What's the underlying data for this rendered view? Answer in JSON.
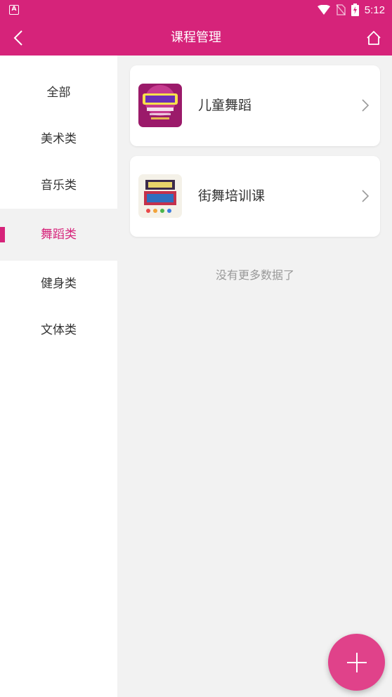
{
  "status_bar": {
    "app_icon_letter": "A",
    "time": "5:12",
    "icons": [
      "wifi-icon",
      "no-sim-icon",
      "battery-charging-icon"
    ]
  },
  "header": {
    "title": "课程管理",
    "back_icon": "back-arrow-icon",
    "home_icon": "home-icon"
  },
  "sidebar": {
    "items": [
      {
        "label": "全部",
        "active": false
      },
      {
        "label": "美术类",
        "active": false
      },
      {
        "label": "音乐类",
        "active": false
      },
      {
        "label": "舞蹈类",
        "active": true
      },
      {
        "label": "健身类",
        "active": false
      },
      {
        "label": "文体类",
        "active": false
      }
    ]
  },
  "courses": [
    {
      "name": "儿童舞蹈",
      "thumb_icon": "course-thumbnail-image"
    },
    {
      "name": "街舞培训课",
      "thumb_icon": "course-thumbnail-image"
    }
  ],
  "list_footer": "没有更多数据了",
  "fab": {
    "icon": "plus-icon"
  },
  "colors": {
    "primary": "#d6237a",
    "fab": "#e0428a",
    "background": "#f2f2f2"
  }
}
